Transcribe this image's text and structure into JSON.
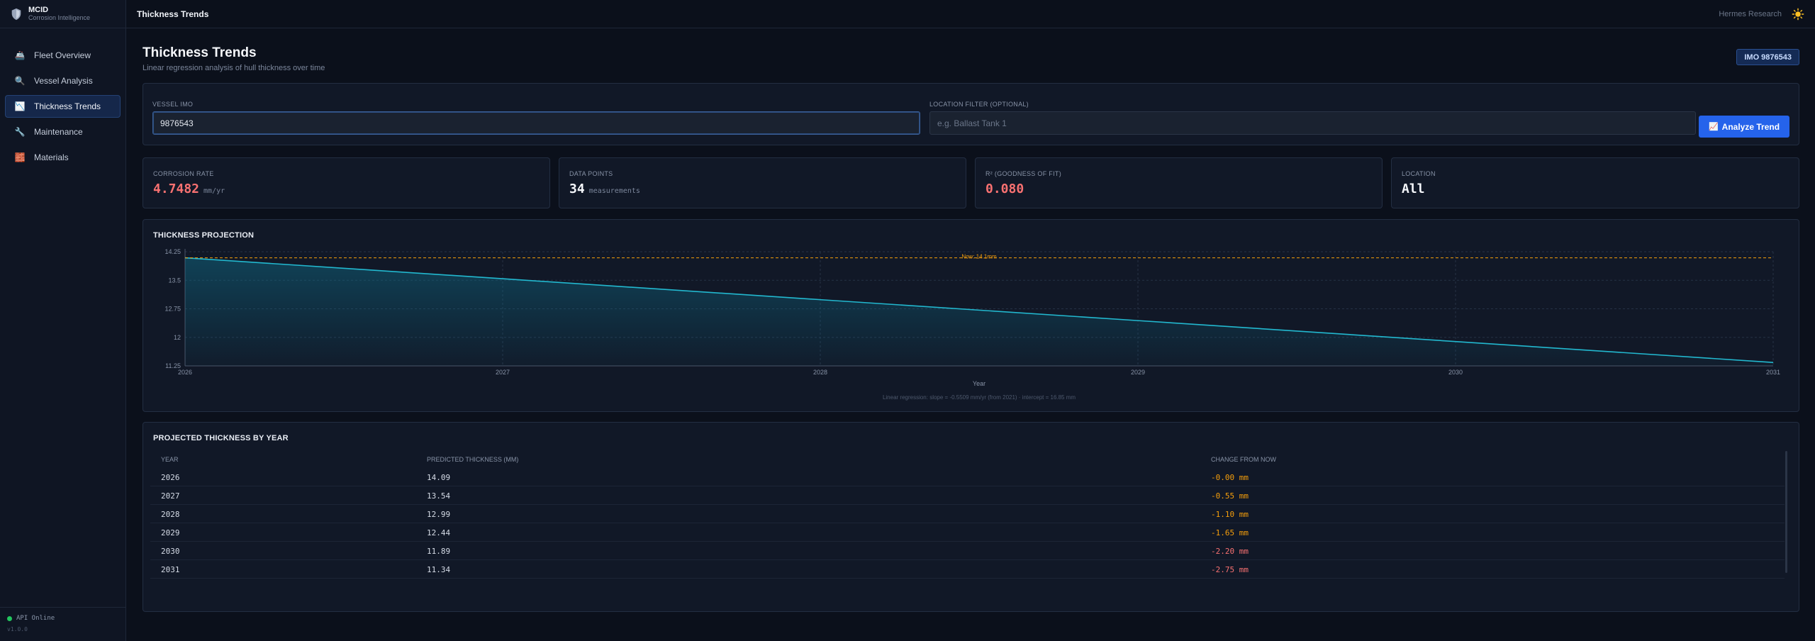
{
  "brand": {
    "title": "MCID",
    "subtitle": "Corrosion Intelligence"
  },
  "nav": [
    {
      "label": "Fleet Overview",
      "icon": "ship-icon"
    },
    {
      "label": "Vessel Analysis",
      "icon": "magnifier-icon"
    },
    {
      "label": "Thickness Trends",
      "icon": "chart-icon",
      "active": true
    },
    {
      "label": "Maintenance",
      "icon": "wrench-icon"
    },
    {
      "label": "Materials",
      "icon": "bricks-icon"
    }
  ],
  "footer": {
    "status": "API Online",
    "version": "v1.0.0"
  },
  "topbar": {
    "title": "Thickness Trends",
    "org": "Hermes Research"
  },
  "page": {
    "title": "Thickness Trends",
    "subtitle": "Linear regression analysis of hull thickness over time",
    "imo_badge": "IMO 9876543"
  },
  "form": {
    "vessel_label": "Vessel IMO",
    "vessel_value": "9876543",
    "location_label": "Location Filter (Optional)",
    "location_placeholder": "e.g. Ballast Tank 1",
    "button_icon": "📈",
    "button_label": "Analyze Trend"
  },
  "stats": [
    {
      "label": "Corrosion Rate",
      "value": "4.7482",
      "unit": "mm/yr",
      "color": "#f87171"
    },
    {
      "label": "Data Points",
      "value": "34",
      "unit": "measurements",
      "color": "#f5f7fb"
    },
    {
      "label": "R² (Goodness of Fit)",
      "value": "0.080",
      "unit": "",
      "color": "#f87171"
    },
    {
      "label": "Location",
      "value": "All",
      "unit": "",
      "color": "#f5f7fb"
    }
  ],
  "chart_data": {
    "type": "area",
    "title": "Thickness Projection",
    "xlabel": "Year",
    "ylabel": "",
    "x": [
      2026,
      2027,
      2028,
      2029,
      2030,
      2031
    ],
    "series": [
      {
        "values": [
          14.09,
          13.54,
          12.99,
          12.44,
          11.89,
          11.34
        ]
      }
    ],
    "xticks": [
      "2026",
      "2027",
      "2028",
      "2029",
      "2030",
      "2031"
    ],
    "yticks": [
      "14.25",
      "13.5",
      "12.75",
      "12",
      "11.25"
    ],
    "ylim": [
      11.25,
      14.25
    ],
    "reference_line": {
      "value": 14.09,
      "label": "Now: 14.1mm",
      "color": "#f59e0b"
    },
    "grid": true,
    "line_color": "#22b8cf",
    "footnote": "Linear regression: slope = -0.5509 mm/yr (from 2021) · intercept = 16.85 mm"
  },
  "table": {
    "title": "Projected Thickness by Year",
    "columns": [
      "Year",
      "Predicted Thickness (mm)",
      "Change from Now"
    ],
    "rows": [
      [
        "2026",
        "14.09",
        "-0.00 mm"
      ],
      [
        "2027",
        "13.54",
        "-0.55 mm"
      ],
      [
        "2028",
        "12.99",
        "-1.10 mm"
      ],
      [
        "2029",
        "12.44",
        "-1.65 mm"
      ],
      [
        "2030",
        "11.89",
        "-2.20 mm"
      ],
      [
        "2031",
        "11.34",
        "-2.75 mm"
      ]
    ]
  }
}
